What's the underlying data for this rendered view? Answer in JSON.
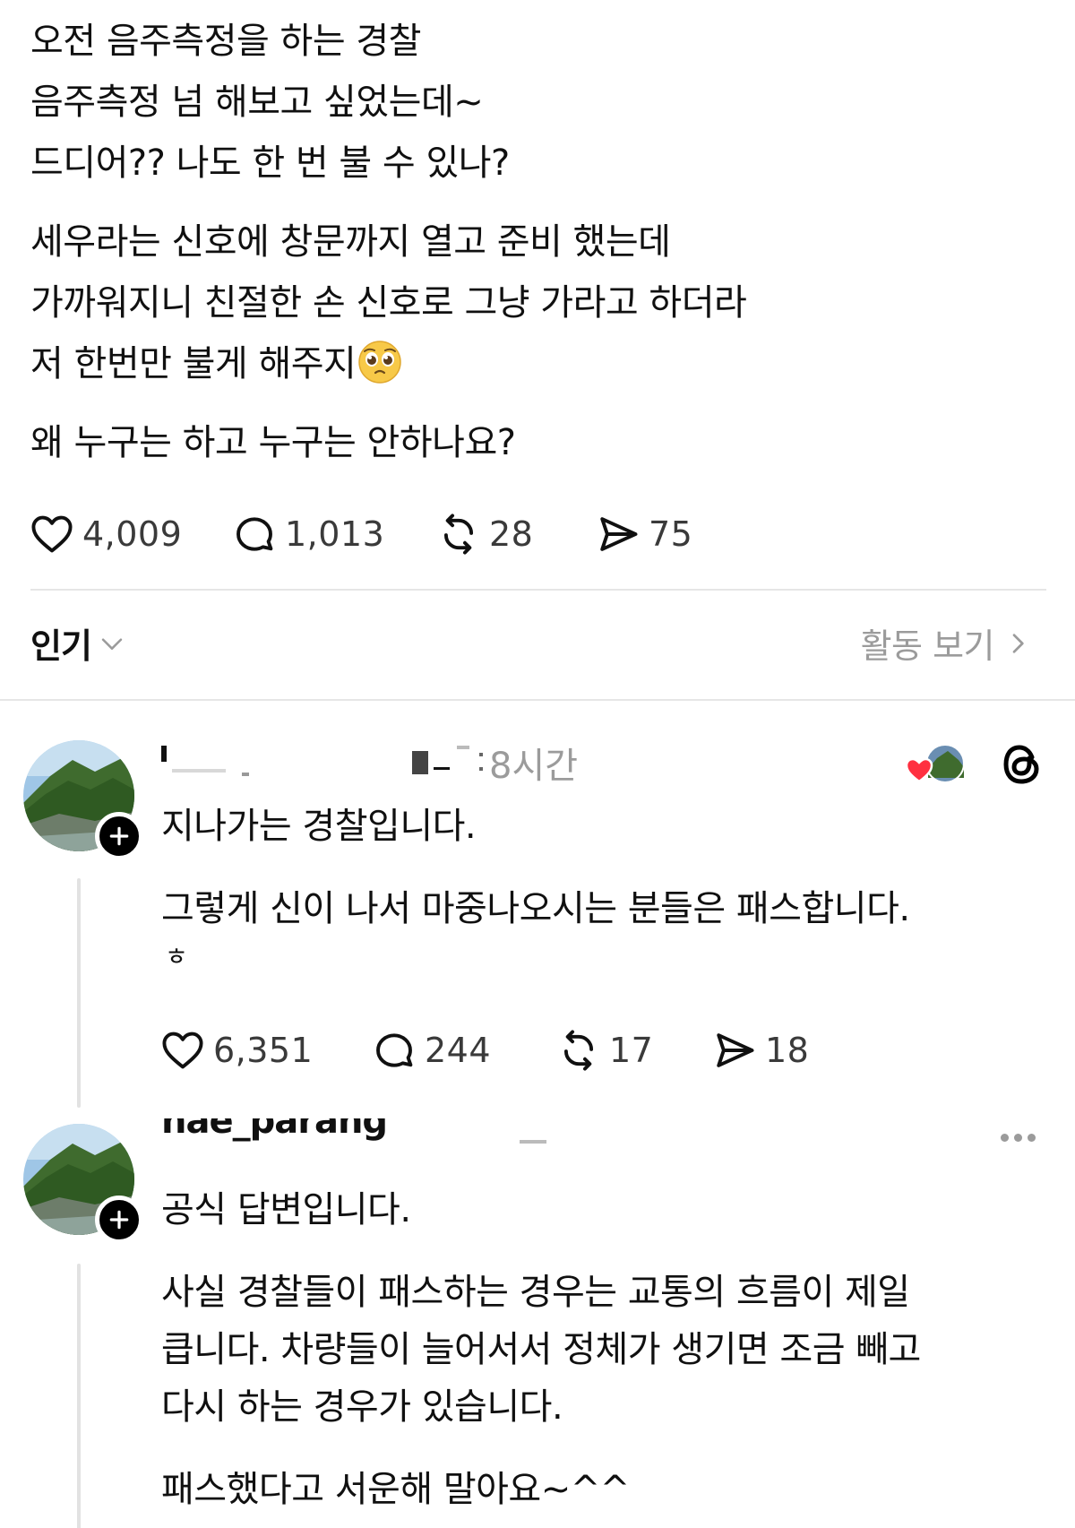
{
  "post": {
    "paragraphs": [
      [
        "오전 음주측정을 하는 경찰",
        "음주측정 넘 해보고 싶었는데~",
        "드디어?? 나도 한 번 불 수 있나?"
      ],
      [
        "세우라는 신호에 창문까지 열고 준비 했는데",
        "가까워지니 친절한 손 신호로 그냥 가라고 하더라",
        "저 한번만 불게 해주지"
      ],
      [
        "왜 누구는 하고 누구는 안하나요?"
      ]
    ],
    "emoji": "pleading-face",
    "stats": {
      "likes": "4,009",
      "replies": "1,013",
      "reposts": "28",
      "shares": "75"
    }
  },
  "sort": {
    "label": "인기",
    "activity_label": "활동 보기"
  },
  "replies": [
    {
      "time": "8시간",
      "text_paragraphs": [
        [
          "지나가는 경찰입니다."
        ],
        [
          "그렇게 신이 나서 마중나오시는 분들은 패스합니다.",
          "ㅎ"
        ]
      ],
      "stats": {
        "likes": "6,351",
        "replies": "244",
        "reposts": "17",
        "shares": "18"
      }
    },
    {
      "username_partial": "hae_parang",
      "text_paragraphs": [
        [
          "공식 답변입니다."
        ],
        [
          "사실 경찰들이 패스하는 경우는 교통의 흐름이 제일",
          "큽니다. 차량들이 늘어서서 정체가 생기면 조금 빼고",
          "다시 하는 경우가 있습니다."
        ],
        [
          "패스했다고 서운해 말아요~^^"
        ]
      ]
    }
  ],
  "colors": {
    "text": "#101010",
    "muted": "#9b9b9b",
    "divider": "#e6e6e6",
    "heart_red": "#ff3040"
  }
}
